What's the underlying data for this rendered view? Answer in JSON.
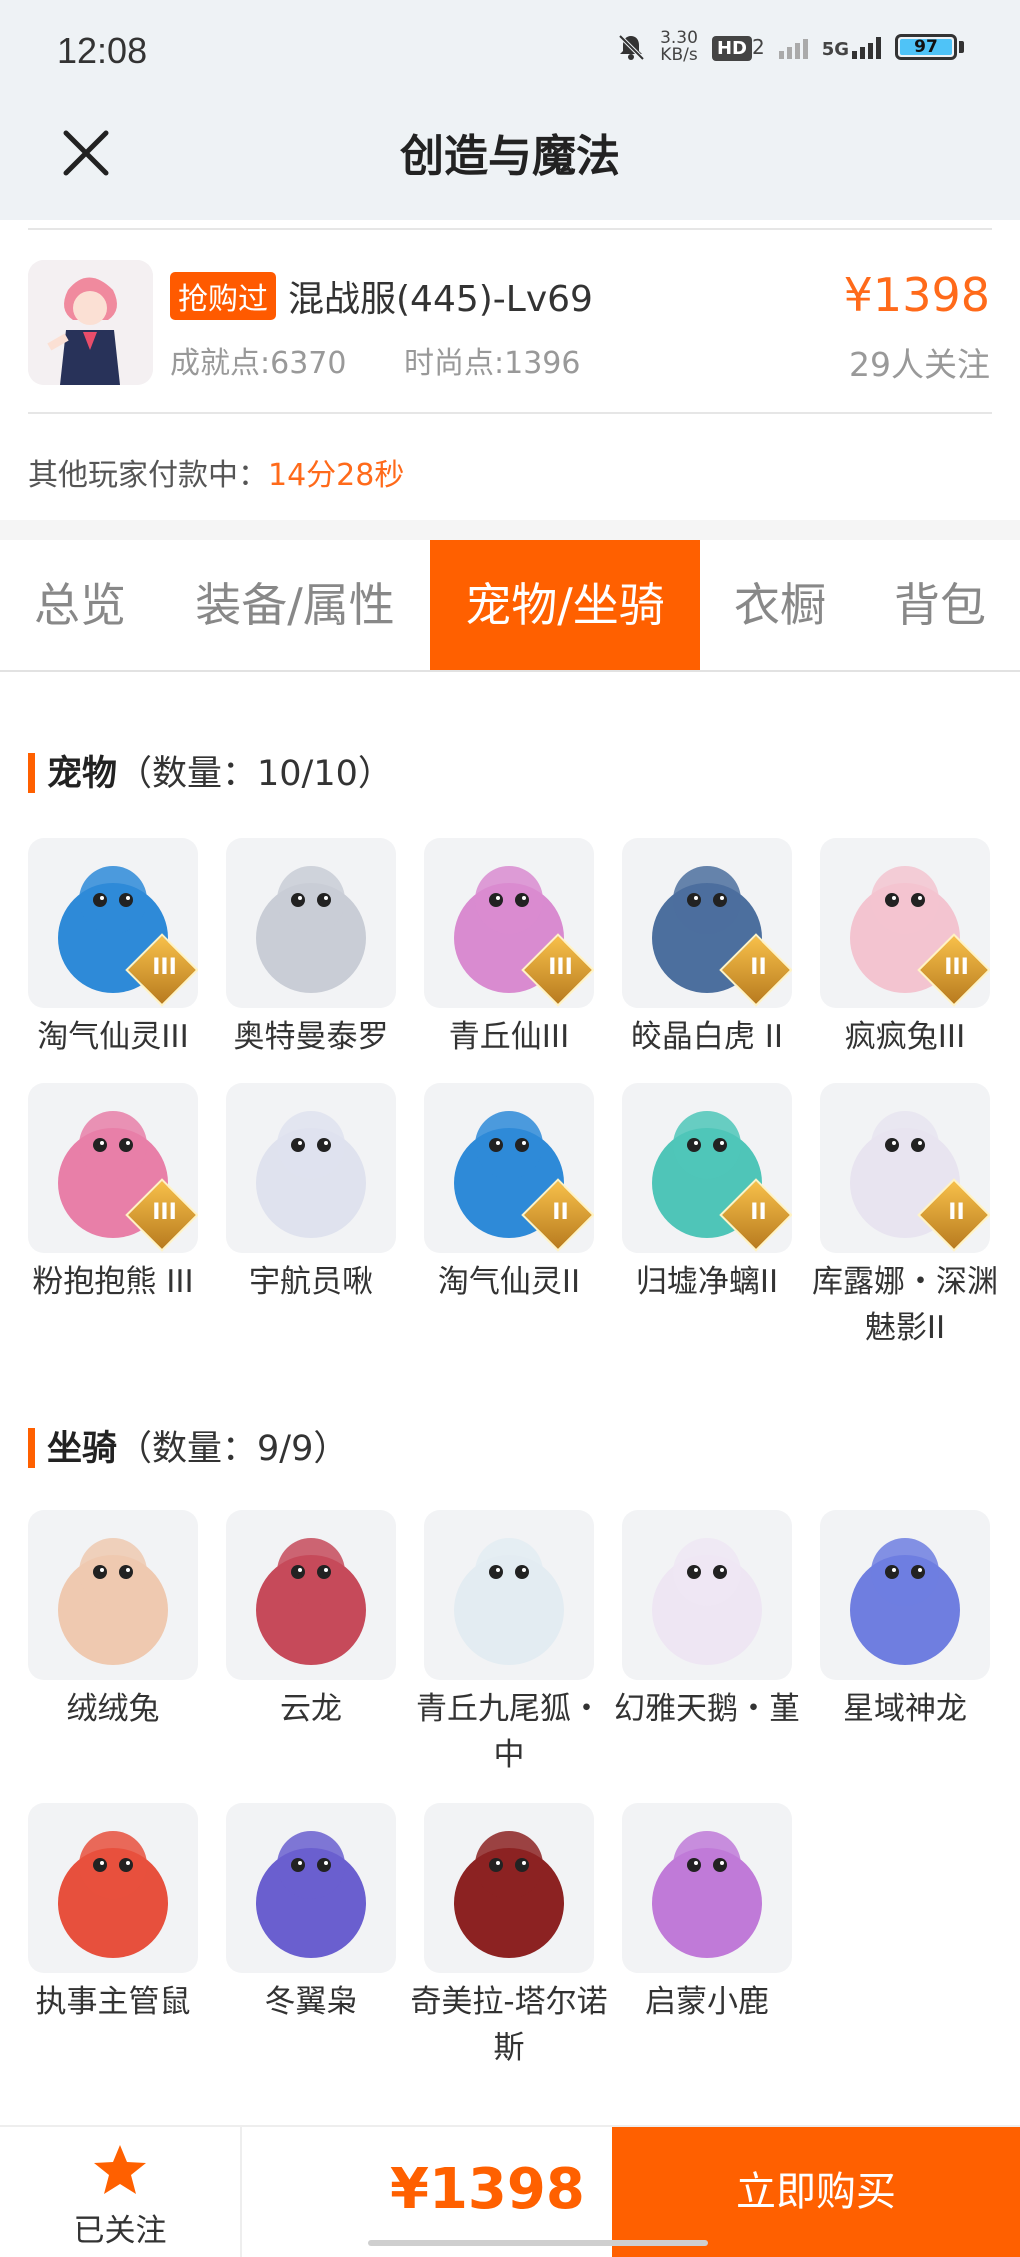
{
  "status_bar": {
    "time": "12:08",
    "speed_value": "3.30",
    "speed_unit": "KB/s",
    "hd_label": "HD",
    "hd_sub": "2",
    "network": "5G",
    "battery": "97"
  },
  "nav": {
    "title": "创造与魔法"
  },
  "product": {
    "badge": "抢购过",
    "server": "混战服(445)-Lv69",
    "achievement": "成就点:6370",
    "fashion": "时尚点:1396",
    "price": "¥1398",
    "followers": "29人关注",
    "paying_label": "其他玩家付款中：",
    "paying_time": "14分28秒"
  },
  "tabs": [
    {
      "label": "总览"
    },
    {
      "label": "装备/属性"
    },
    {
      "label": "宠物/坐骑"
    },
    {
      "label": "衣橱"
    },
    {
      "label": "背包"
    }
  ],
  "active_tab": "宠物/坐骑",
  "pets": {
    "title": "宠物",
    "count": "（数量：10/10）",
    "items": [
      {
        "name": "淘气仙灵III",
        "rank": "III",
        "color": "#2e8ad8"
      },
      {
        "name": "奥特曼泰罗",
        "rank": "",
        "color": "#c9cdd6"
      },
      {
        "name": "青丘仙III",
        "rank": "III",
        "color": "#d98bd0"
      },
      {
        "name": "皎晶白虎 II",
        "rank": "II",
        "color": "#4c6f9e"
      },
      {
        "name": "疯疯兔III",
        "rank": "III",
        "color": "#f3c4d0"
      },
      {
        "name": "粉抱抱熊 III",
        "rank": "III",
        "color": "#e87fa8"
      },
      {
        "name": "宇航员啾",
        "rank": "",
        "color": "#dfe2ee"
      },
      {
        "name": "淘气仙灵II",
        "rank": "II",
        "color": "#2e8ad8"
      },
      {
        "name": "归墟净螭II",
        "rank": "II",
        "color": "#4fc5b8"
      },
      {
        "name": "库露娜・深渊魅影II",
        "rank": "II",
        "color": "#e8e4f0"
      }
    ]
  },
  "mounts": {
    "title": "坐骑",
    "count": "（数量：9/9）",
    "items": [
      {
        "name": "绒绒兔",
        "color": "#efc9b0"
      },
      {
        "name": "云龙",
        "color": "#c64a5a"
      },
      {
        "name": "青丘九尾狐・中",
        "color": "#e3ecf2"
      },
      {
        "name": "幻雅天鹅・堇",
        "color": "#eee6f3"
      },
      {
        "name": "星域神龙",
        "color": "#6f7ee0"
      },
      {
        "name": "执事主管鼠",
        "color": "#e7503d"
      },
      {
        "name": "冬翼枭",
        "color": "#6a5fcf"
      },
      {
        "name": "奇美拉-塔尔诺斯",
        "color": "#8c2222"
      },
      {
        "name": "启蒙小鹿",
        "color": "#c07ad8"
      }
    ]
  },
  "bottom": {
    "follow_label": "已关注",
    "price": "¥1398",
    "buy_label": "立即购买"
  }
}
